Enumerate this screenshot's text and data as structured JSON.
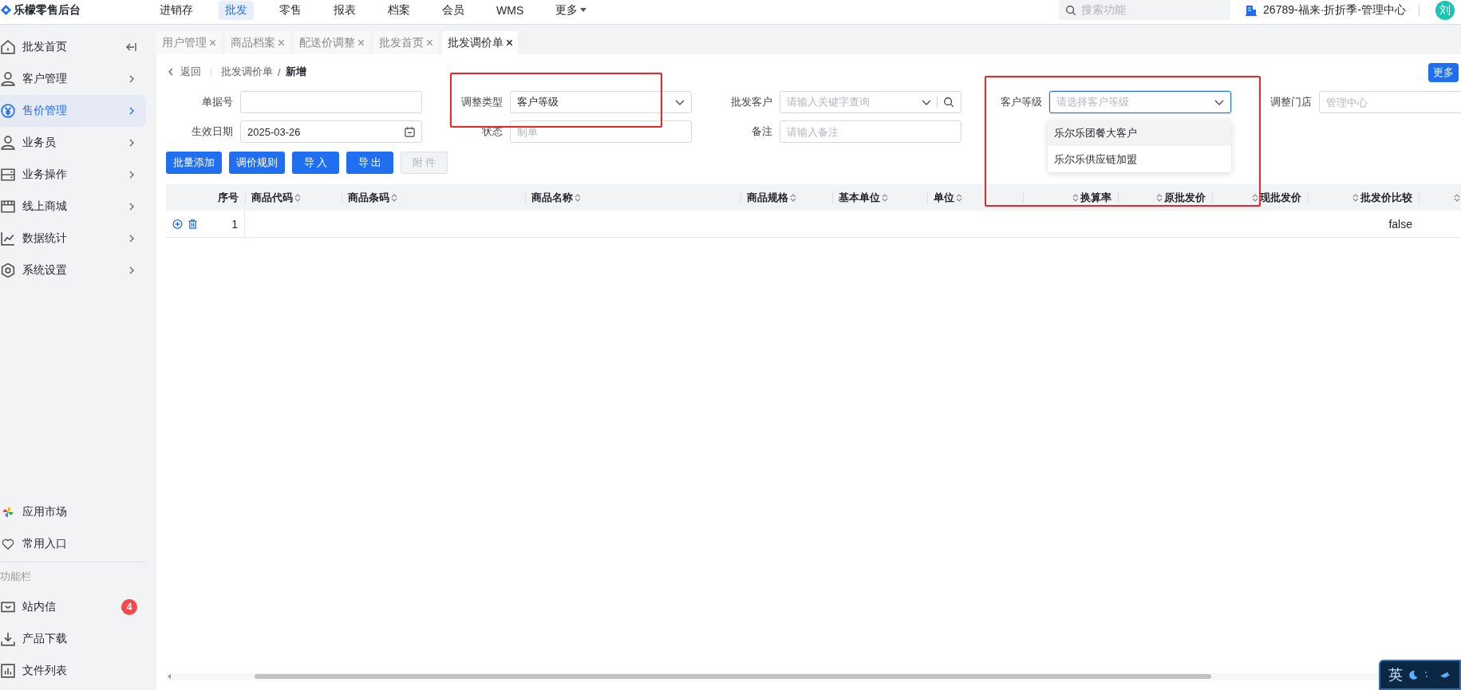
{
  "app": {
    "title": "乐檬零售后台"
  },
  "top_nav": [
    {
      "label": "进销存",
      "selected": false,
      "has_menu": false
    },
    {
      "label": "批发",
      "selected": true,
      "has_menu": false
    },
    {
      "label": "零售",
      "selected": false,
      "has_menu": false
    },
    {
      "label": "报表",
      "selected": false,
      "has_menu": false
    },
    {
      "label": "档案",
      "selected": false,
      "has_menu": false
    },
    {
      "label": "会员",
      "selected": false,
      "has_menu": false
    },
    {
      "label": "WMS",
      "selected": false,
      "has_menu": false
    },
    {
      "label": "更多",
      "selected": false,
      "has_menu": true
    }
  ],
  "search": {
    "placeholder": "搜索功能"
  },
  "organization": "26789-福来·折折季-管理中心",
  "user": {
    "avatar": "刘"
  },
  "sidebar": {
    "menu": [
      {
        "label": "批发首页",
        "selected": false
      },
      {
        "label": "客户管理",
        "selected": false
      },
      {
        "label": "售价管理",
        "selected": true
      },
      {
        "label": "业务员",
        "selected": false
      },
      {
        "label": "业务操作",
        "selected": false
      },
      {
        "label": "线上商城",
        "selected": false
      },
      {
        "label": "数据统计",
        "selected": false
      },
      {
        "label": "系统设置",
        "selected": false
      }
    ],
    "shortcuts": [
      "应用市场",
      "常用入口"
    ],
    "section_label": "功能栏",
    "tools": [
      {
        "label": "站内信",
        "badge": "4"
      },
      {
        "label": "产品下载"
      },
      {
        "label": "文件列表"
      }
    ]
  },
  "tabs": [
    {
      "label": "用户管理",
      "selected": false
    },
    {
      "label": "商品档案",
      "selected": false
    },
    {
      "label": "配送价调整",
      "selected": false
    },
    {
      "label": "批发首页",
      "selected": false
    },
    {
      "label": "批发调价单",
      "selected": true
    }
  ],
  "breadcrumb": {
    "back": "返回",
    "items": [
      "批发调价单",
      "新增"
    ],
    "separator": "/"
  },
  "more_button": "更多",
  "form": {
    "fields": [
      {
        "label": "单据号",
        "kind": "text",
        "focused": false
      },
      {
        "label": "调整类型",
        "kind": "select",
        "value": "客户等级",
        "focused": false
      },
      {
        "label": "批发客户",
        "kind": "search-select",
        "placeholder": "请输入关键字查询",
        "focused": false
      },
      {
        "label": "客户等级",
        "kind": "select",
        "placeholder": "请选择客户等级",
        "focused": true,
        "options": [
          {
            "label": "乐尔乐团餐大客户",
            "hovered": true
          },
          {
            "label": "乐尔乐供应链加盟",
            "hovered": false
          }
        ]
      },
      {
        "label": "调整门店",
        "kind": "text",
        "placeholder": "管理中心",
        "focused": false
      },
      {
        "label": "生效日期",
        "kind": "date",
        "value": "2025-03-26",
        "focused": false
      },
      {
        "label": "状态",
        "kind": "text",
        "placeholder": "制单",
        "focused": false
      },
      {
        "label": "备注",
        "kind": "text",
        "placeholder": "请输入备注",
        "focused": false
      }
    ]
  },
  "actions": [
    {
      "label": "批量添加",
      "disabled": false
    },
    {
      "label": "调价规则",
      "disabled": false
    },
    {
      "label": "导 入",
      "disabled": false
    },
    {
      "label": "导 出",
      "disabled": false
    },
    {
      "label": "附 件",
      "disabled": true
    }
  ],
  "table": {
    "columns": [
      {
        "label": "序号",
        "sortable": false
      },
      {
        "label": "商品代码",
        "sortable": true
      },
      {
        "label": "商品条码",
        "sortable": true
      },
      {
        "label": "商品名称",
        "sortable": true
      },
      {
        "label": "商品规格",
        "sortable": true
      },
      {
        "label": "基本单位",
        "sortable": true
      },
      {
        "label": "单位",
        "sortable": true
      },
      {
        "label": "换算率",
        "sortable": true
      },
      {
        "label": "原批发价",
        "sortable": true
      },
      {
        "label": "现批发价",
        "sortable": true
      },
      {
        "label": "批发价比较",
        "sortable": true
      },
      {
        "sortable": true
      }
    ],
    "rows": [
      {
        "cells": [
          "1",
          null,
          null,
          null,
          null,
          null,
          null,
          null,
          null,
          null,
          "false",
          null
        ]
      }
    ]
  },
  "ime_toolbar": {
    "mode": "英"
  }
}
